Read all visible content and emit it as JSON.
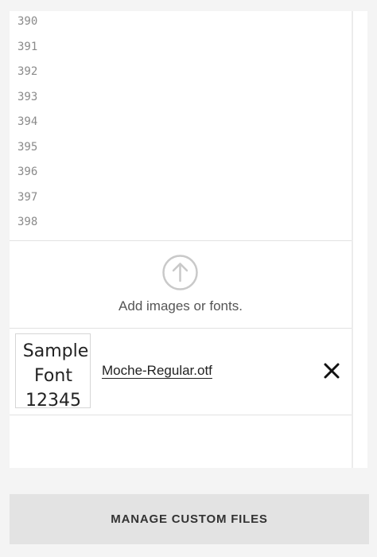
{
  "editor": {
    "line_numbers": [
      "390",
      "391",
      "392",
      "393",
      "394",
      "395",
      "396",
      "397",
      "398"
    ]
  },
  "upload": {
    "label": "Add images or fonts.",
    "icon": "arrow-up-circle-icon"
  },
  "files": [
    {
      "name": "Moche-Regular.otf",
      "preview_lines": [
        "Sample",
        "Font",
        "12345"
      ],
      "remove_icon": "close-icon"
    }
  ],
  "manage_button": {
    "label": "MANAGE CUSTOM FILES"
  }
}
